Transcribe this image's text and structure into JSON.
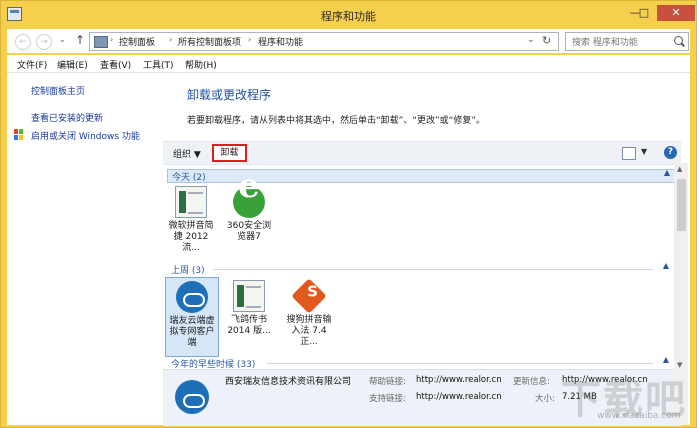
{
  "window": {
    "title": "程序和功能",
    "minimize": "—",
    "maximize": "□",
    "close": "✕"
  },
  "address": {
    "crumbs": [
      "控制面板",
      "所有控制面板项",
      "程序和功能"
    ],
    "separator": "›",
    "search_placeholder": "搜索 程序和功能",
    "back": "←",
    "forward": "→",
    "up": "↑",
    "history": "⌄",
    "dropdown": "⌄",
    "refresh": "↻"
  },
  "menu": [
    "文件(F)",
    "编辑(E)",
    "查看(V)",
    "工具(T)",
    "帮助(H)"
  ],
  "sidebar": {
    "links": [
      "控制面板主页",
      "查看已安装的更新",
      "启用或关闭 Windows 功能"
    ]
  },
  "main": {
    "heading": "卸载或更改程序",
    "description": "若要卸载程序，请从列表中将其选中，然后单击“卸载”、“更改”或“修复”。"
  },
  "toolbar": {
    "organize": "组织 ▼",
    "uninstall": "卸载",
    "view_dropdown": "▼",
    "help": "?"
  },
  "groups": [
    {
      "label": "今天 (2)",
      "items": [
        "微软拼音简捷 2012 流...",
        "360安全浏览器7"
      ]
    },
    {
      "label": "上周 (3)",
      "items": [
        "瑞友云端虚拟专网客户端",
        "飞鸽传书 2014 版...",
        "搜狗拼音输入法 7.4正..."
      ]
    },
    {
      "label": "今年的早些时候 (33)",
      "items": []
    }
  ],
  "details": {
    "publisher": "西安瑞友信息技术资讯有限公司",
    "help_link_label": "帮助链接:",
    "help_link": "http://www.realor.cn",
    "update_label": "更新信息:",
    "update_link": "http://www.realor.cn",
    "support_label": "支持链接:",
    "support_link": "http://www.realor.cn",
    "size_label": "大小:",
    "size": "7.21 MB"
  },
  "watermark": {
    "logo": "下载吧",
    "url": "www.xiazaiba.com"
  }
}
